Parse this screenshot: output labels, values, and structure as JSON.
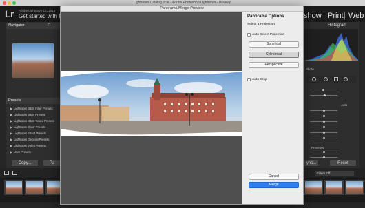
{
  "window": {
    "title": "Lightroom Catalog.lrcat - Adobe Photoshop Lightroom - Develop",
    "traffic_colors": [
      "#fc5f57",
      "#fdbc2e",
      "#34c84a"
    ]
  },
  "lightroom": {
    "logo": "Lr",
    "brand_line": "Adobe Lightroom CC 2015",
    "headline": "Get started with Lig",
    "modules": [
      "show",
      "Print",
      "Web"
    ],
    "left_panel": {
      "navigator_label": "Navigator",
      "fit_label": "FI",
      "presets_label": "Presets",
      "presets": [
        "Lightroom B&W Filter Presets",
        "Lightroom B&W Presets",
        "Lightroom B&W Toned Presets",
        "Lightroom Color Presets",
        "Lightroom Effect Presets",
        "Lightroom General Presets",
        "Lightroom Video Presets",
        "User Presets"
      ],
      "copy_label": "Copy...",
      "paste_label": "Pa"
    },
    "right_panel": {
      "histogram_label": "Histogram",
      "photo_label": "Photo",
      "auto_label": "Auto",
      "presence_label": "Presence",
      "reset_label": "Reset",
      "sync_label": "ync..."
    },
    "filmstrip": {
      "filter_label": "Filters Off"
    }
  },
  "dialog": {
    "title": "Panorama Merge Preview",
    "options_heading": "Panorama Options",
    "projection_heading": "Select a Projection",
    "auto_select_label": "Auto Select Projection",
    "projections": [
      {
        "label": "Spherical",
        "selected": false
      },
      {
        "label": "Cylindrical",
        "selected": true
      },
      {
        "label": "Perspective",
        "selected": false
      }
    ],
    "auto_crop_label": "Auto Crop",
    "cancel_label": "Cancel",
    "merge_label": "Merge",
    "merge_color": "#2f7ff0"
  }
}
